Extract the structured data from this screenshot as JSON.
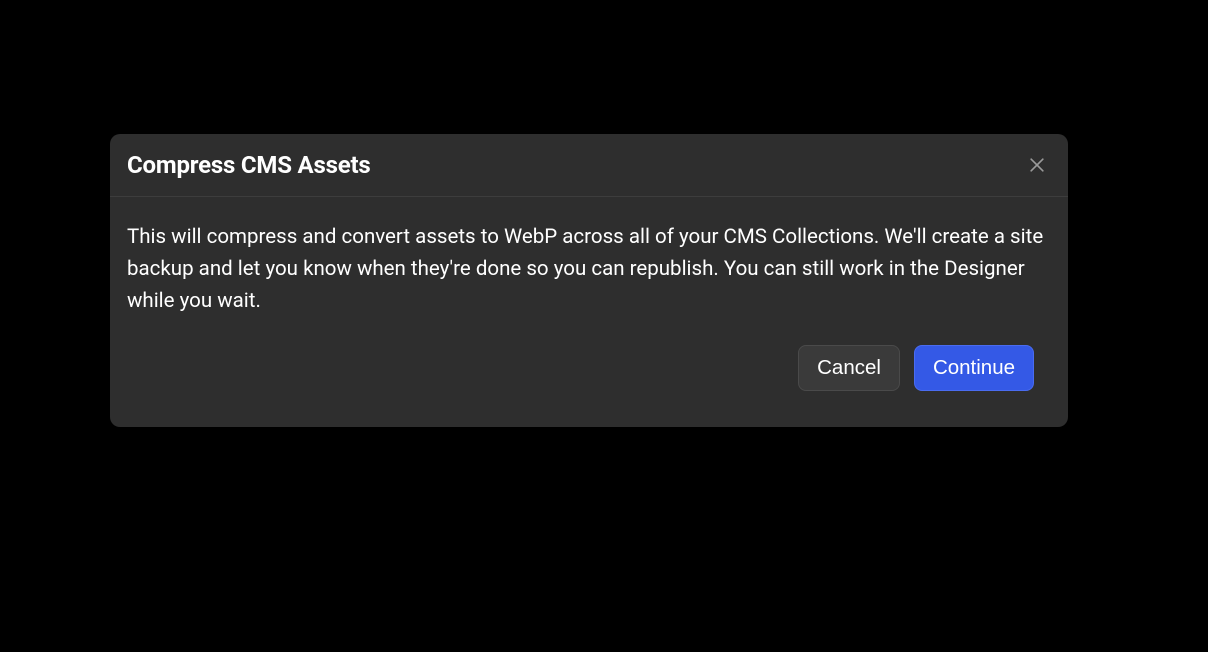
{
  "modal": {
    "title": "Compress CMS Assets",
    "description": "This will compress and convert assets to WebP across all of your CMS Collections. We'll create a site backup and let you know when they're done so you can republish. You can still work in the Designer while you wait.",
    "cancel_label": "Cancel",
    "continue_label": "Continue"
  },
  "colors": {
    "background": "#000000",
    "modal_bg": "#2e2e2e",
    "text": "#ffffff",
    "primary_button": "#3459e6",
    "secondary_button": "#3a3a3a"
  }
}
